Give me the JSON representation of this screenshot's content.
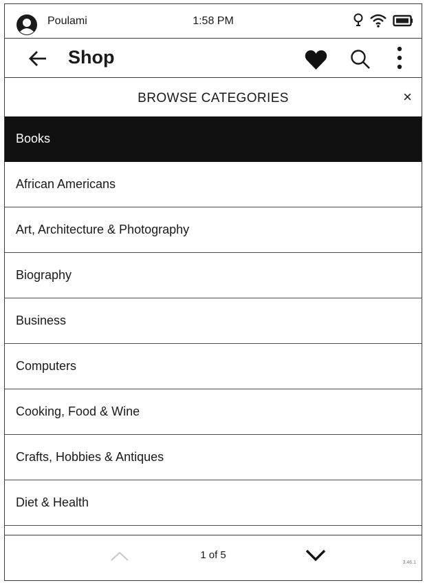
{
  "status": {
    "user": "Poulami",
    "time": "1:58 PM"
  },
  "header": {
    "title": "Shop"
  },
  "browse": {
    "title": "BROWSE CATEGORIES",
    "close": "×"
  },
  "categories": [
    "Books",
    "African Americans",
    "Art, Architecture & Photography",
    "Biography",
    "Business",
    "Computers",
    "Cooking, Food & Wine",
    "Crafts, Hobbies & Antiques",
    "Diet & Health"
  ],
  "selected_index": 0,
  "footer": {
    "page": "1 of 5",
    "version": "3.46.1"
  }
}
